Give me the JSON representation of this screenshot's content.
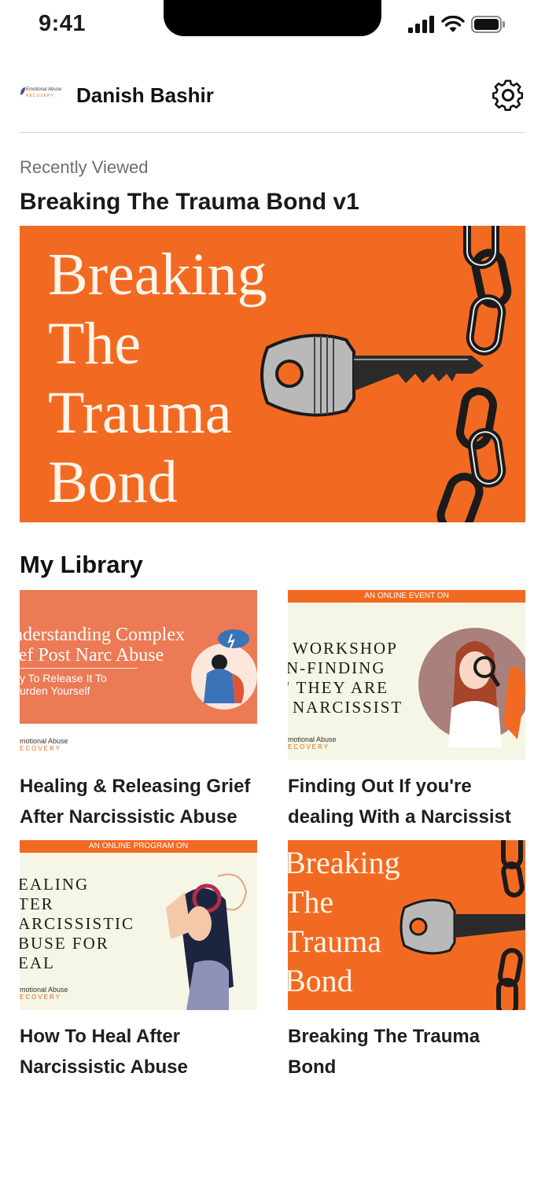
{
  "status": {
    "time": "9:41"
  },
  "header": {
    "logo_line1": "Emotional Abuse",
    "logo_line2": "RECOVERY",
    "user_name": "Danish Bashir"
  },
  "recent": {
    "label": "Recently Viewed",
    "title": "Breaking The Trauma Bond v1",
    "hero_lines": [
      "Breaking",
      "The",
      "Trauma",
      "Bond"
    ]
  },
  "library": {
    "title": "My Library",
    "items": [
      {
        "title": "Healing & Releasing Grief After Narcissistic Abuse",
        "thumb_heading_1": "nderstanding Complex",
        "thumb_heading_2": "ief Post Narc Abuse",
        "thumb_sub_1": "y To Release It To",
        "thumb_sub_2": "urden Yourself",
        "thumb_logo_1": "motional Abuse",
        "thumb_logo_2": "ECOVERY"
      },
      {
        "title": "Finding Out If you're dealing With a Narcissist",
        "thumb_band": "AN ONLINE EVENT ON",
        "thumb_lines": [
          "WORKSHOP",
          "N-FINDING",
          "' THEY ARE",
          "NARCISSIST"
        ],
        "thumb_logo_1": "motional Abuse",
        "thumb_logo_2": "ECOVERY"
      },
      {
        "title": "How To Heal After Narcissistic Abuse",
        "thumb_band": "AN ONLINE PROGRAM ON",
        "thumb_lines": [
          "EALING",
          "TER",
          "ARCISSISTIC",
          "BUSE FOR",
          "EAL"
        ],
        "thumb_logo_1": "motional Abuse",
        "thumb_logo_2": "ECOVERY"
      },
      {
        "title": "Breaking The Trauma Bond",
        "thumb_lines": [
          "Breaking",
          "The",
          "Trauma",
          "Bond"
        ]
      }
    ]
  },
  "colors": {
    "brand_orange": "#f26a21",
    "cream": "#f6f6e6",
    "salmon": "#ec7a55"
  },
  "icons": [
    "signal-icon",
    "wifi-icon",
    "battery-icon",
    "settings-gear-icon",
    "key-icon",
    "chain-icon"
  ]
}
